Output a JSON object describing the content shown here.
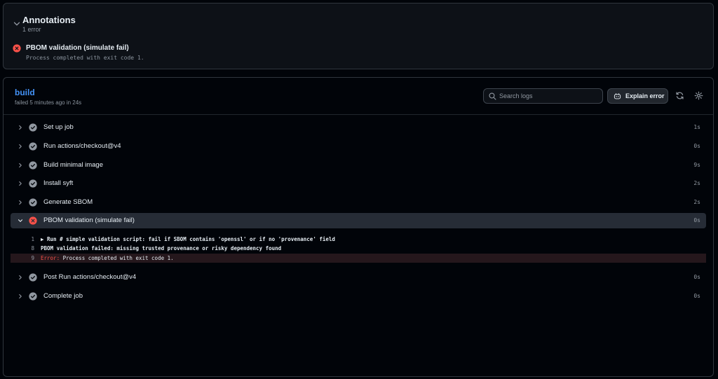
{
  "annotations": {
    "title": "Annotations",
    "count": "1 error",
    "item_title": "PBOM validation (simulate fail)",
    "item_message": "Process completed with exit code 1."
  },
  "job": {
    "name": "build",
    "status": "failed 5 minutes ago in 24s",
    "search_placeholder": "Search logs",
    "explain_label": "Explain error"
  },
  "steps": [
    {
      "label": "Set up job",
      "duration": "1s",
      "status": "success"
    },
    {
      "label": "Run actions/checkout@v4",
      "duration": "0s",
      "status": "success"
    },
    {
      "label": "Build minimal image",
      "duration": "9s",
      "status": "success"
    },
    {
      "label": "Install syft",
      "duration": "2s",
      "status": "success"
    },
    {
      "label": "Generate SBOM",
      "duration": "2s",
      "status": "success"
    },
    {
      "label": "PBOM validation (simulate fail)",
      "duration": "0s",
      "status": "failure",
      "expanded": true
    },
    {
      "label": "Post Run actions/checkout@v4",
      "duration": "0s",
      "status": "success"
    },
    {
      "label": "Complete job",
      "duration": "0s",
      "status": "success"
    }
  ],
  "log": [
    {
      "line": "1",
      "text": "▶ Run # simple validation script: fail if SBOM contains 'openssl' or if no 'provenance' field"
    },
    {
      "line": "8",
      "text": "PBOM validation failed: missing trusted provenance or risky dependency found"
    },
    {
      "line": "9",
      "prefix": "Error:",
      "text": " Process completed with exit code 1."
    }
  ],
  "colors": {
    "accent": "#4493f8",
    "error": "#f85149",
    "success_icon": "#9198a1",
    "background": "#010409"
  }
}
